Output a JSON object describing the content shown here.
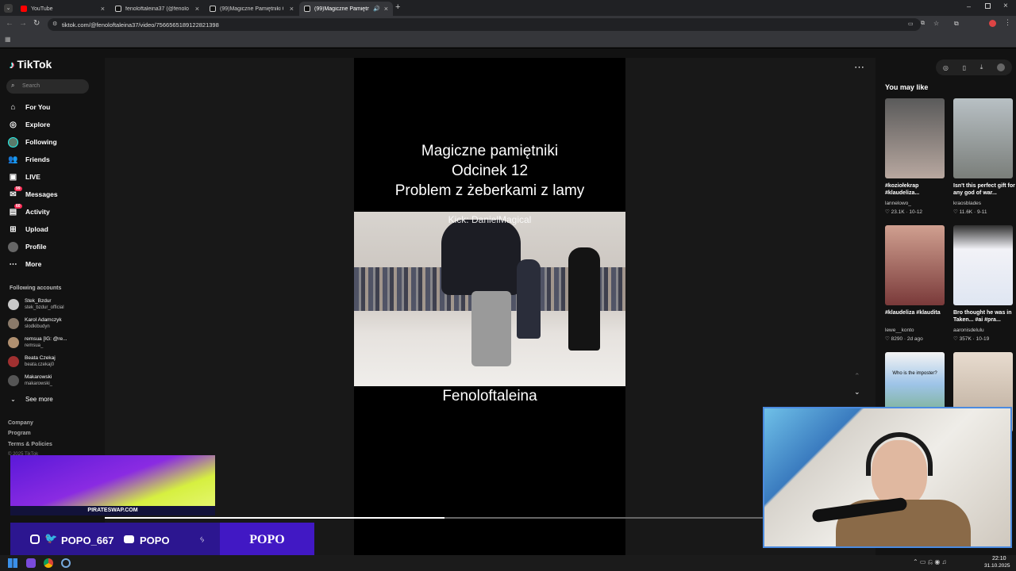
{
  "browser": {
    "tabs": [
      {
        "label": "YouTube",
        "favicon": "youtube-icon",
        "color": "#ff0000",
        "active": false
      },
      {
        "label": "fenoloftaleina37 (@fenoloftalei...",
        "favicon": "tiktok-icon",
        "color": "#ffffff",
        "active": false
      },
      {
        "label": "(99)Magiczne Pamiętniki Odcin...",
        "favicon": "tiktok-icon",
        "color": "#ffffff",
        "active": false
      },
      {
        "label": "(99)Magiczne Pamiętniki O...",
        "favicon": "tiktok-icon",
        "color": "#ffffff",
        "active": true
      }
    ],
    "url": "tiktok.com/@fenoloftaleina37/video/7566565189122821398"
  },
  "tiktok": {
    "logo_text": "TikTok",
    "search_placeholder": "Search",
    "nav": [
      {
        "label": "For You",
        "icon": "home-icon"
      },
      {
        "label": "Explore",
        "icon": "compass-icon"
      },
      {
        "label": "Following",
        "icon": "following-avatar-icon"
      },
      {
        "label": "Friends",
        "icon": "friends-icon"
      },
      {
        "label": "LIVE",
        "icon": "live-icon"
      },
      {
        "label": "Messages",
        "icon": "messages-icon",
        "badge": "99"
      },
      {
        "label": "Activity",
        "icon": "activity-icon",
        "badge": "60"
      },
      {
        "label": "Upload",
        "icon": "upload-icon"
      },
      {
        "label": "Profile",
        "icon": "profile-avatar-icon"
      },
      {
        "label": "More",
        "icon": "more-icon"
      }
    ],
    "following_heading": "Following accounts",
    "following_accounts": [
      {
        "name": "Stek_Bzdur",
        "handle": "stek_bzdur_official",
        "color": "#c8c8c8"
      },
      {
        "name": "Karol Adamczyk",
        "handle": "slodkibudyn",
        "color": "#8a7a6a"
      },
      {
        "name": "remsua [IG: @re...",
        "handle": "remsua_",
        "color": "#b09070"
      },
      {
        "name": "Beata Czekaj",
        "handle": "beata.czekaj0",
        "color": "#a03030"
      },
      {
        "name": "Makarowski",
        "handle": "makarowski_",
        "color": "#555555"
      }
    ],
    "see_more": "See more",
    "footer_links": [
      "Company",
      "Program",
      "Terms & Policies"
    ],
    "copyright": "© 2025 TikTok"
  },
  "video": {
    "caption_lines": [
      "Magiczne pamiętniki",
      "Odcinek 12",
      "Problem z żeberkami z lamy"
    ],
    "overlay_text": "Kick: DanielMagical",
    "bottom_caption": "Fenoloftaleina",
    "progress_fraction": 0.5
  },
  "recommendations": {
    "heading": "You may like",
    "items": [
      {
        "title": "#koziołekrap #klaudeliza...",
        "user": "lannelowo_",
        "likes": "23.1K",
        "date": "10-12",
        "bg": "#8a8a8a"
      },
      {
        "title": "Isn't this perfect gift for any god of war...",
        "user": "kraosblades",
        "likes": "11.6K",
        "date": "9-11",
        "bg": "#9aa0a0"
      },
      {
        "title": "#klaudeliza #klaudita",
        "user": "lewe__konto",
        "likes": "8290",
        "date": "2d ago",
        "bg": "#a85858"
      },
      {
        "title": "Bro thought he was in Taken... #ai #pra...",
        "user": "aaronisdelulu",
        "likes": "357K",
        "date": "10-19",
        "bg": "#e8e8ef"
      },
      {
        "title": "",
        "user": "",
        "likes": "",
        "date": "",
        "bg": "#9ec4e8",
        "label": "Who is the imposter?"
      },
      {
        "title": "",
        "user": "",
        "likes": "",
        "date": "",
        "bg": "#d8c8b8"
      }
    ]
  },
  "stream_overlay": {
    "promo_text": "PIRATESWAP.COM",
    "social_handle_1": "POPO_667",
    "social_handle_2": "POPO",
    "brand": "POPO"
  },
  "taskbar": {
    "time": "22:10",
    "date": "31.10.2025"
  }
}
